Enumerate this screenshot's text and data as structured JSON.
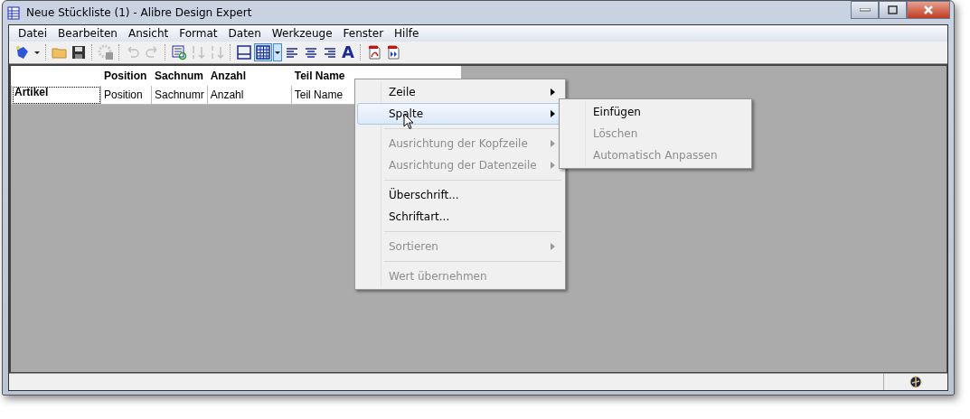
{
  "window": {
    "title": "Neue Stückliste (1) - Alibre Design Expert"
  },
  "menubar": [
    "Datei",
    "Bearbeiten",
    "Ansicht",
    "Format",
    "Daten",
    "Werkzeuge",
    "Fenster",
    "Hilfe"
  ],
  "toolbar": [
    {
      "kind": "new",
      "disabled": false,
      "selected": false
    },
    {
      "kind": "dropdown",
      "disabled": false,
      "selected": false
    },
    {
      "kind": "sep"
    },
    {
      "kind": "open",
      "disabled": false,
      "selected": false
    },
    {
      "kind": "save",
      "disabled": false,
      "selected": false
    },
    {
      "kind": "sep"
    },
    {
      "kind": "settings",
      "disabled": true,
      "selected": false
    },
    {
      "kind": "sep"
    },
    {
      "kind": "undo",
      "disabled": true,
      "selected": false
    },
    {
      "kind": "redo",
      "disabled": true,
      "selected": false
    },
    {
      "kind": "sep"
    },
    {
      "kind": "refresh",
      "disabled": false,
      "selected": false
    },
    {
      "kind": "sortasc",
      "disabled": true,
      "selected": false
    },
    {
      "kind": "sortdesc",
      "disabled": true,
      "selected": false
    },
    {
      "kind": "sep"
    },
    {
      "kind": "border",
      "disabled": false,
      "selected": false
    },
    {
      "kind": "grid",
      "disabled": false,
      "selected": true
    },
    {
      "kind": "dropdown",
      "disabled": false,
      "selected": true
    },
    {
      "kind": "alignleft",
      "disabled": false,
      "selected": false
    },
    {
      "kind": "aligncenter",
      "disabled": false,
      "selected": false
    },
    {
      "kind": "alignright",
      "disabled": false,
      "selected": false
    },
    {
      "kind": "font",
      "glyph": "A",
      "disabled": false,
      "selected": false
    },
    {
      "kind": "sep"
    },
    {
      "kind": "pdf",
      "disabled": false,
      "selected": false
    },
    {
      "kind": "export",
      "disabled": false,
      "selected": false
    }
  ],
  "table": {
    "columns": [
      "Position",
      "Sachnum",
      "Anzahl",
      "Teil Name"
    ],
    "rows": [
      {
        "header": "Artikel",
        "cells": [
          "Position",
          "Sachnumr",
          "Anzahl",
          "Teil Name"
        ]
      }
    ]
  },
  "context_menu": {
    "items": [
      {
        "kind": "item",
        "label": "Zeile",
        "submenu": true,
        "disabled": false,
        "selected": false
      },
      {
        "kind": "item",
        "label": "Spalte",
        "submenu": true,
        "disabled": false,
        "selected": true
      },
      {
        "kind": "separator"
      },
      {
        "kind": "item",
        "label": "Ausrichtung der Kopfzeile",
        "submenu": true,
        "disabled": true,
        "selected": false
      },
      {
        "kind": "item",
        "label": "Ausrichtung der Datenzeile",
        "submenu": true,
        "disabled": true,
        "selected": false
      },
      {
        "kind": "separator"
      },
      {
        "kind": "item",
        "label": "Überschrift...",
        "submenu": false,
        "disabled": false,
        "selected": false
      },
      {
        "kind": "item",
        "label": "Schriftart...",
        "submenu": false,
        "disabled": false,
        "selected": false
      },
      {
        "kind": "separator"
      },
      {
        "kind": "item",
        "label": "Sortieren",
        "submenu": true,
        "disabled": true,
        "selected": false
      },
      {
        "kind": "separator"
      },
      {
        "kind": "item",
        "label": "Wert übernehmen",
        "submenu": false,
        "disabled": true,
        "selected": false
      }
    ]
  },
  "submenu": {
    "items": [
      {
        "label": "Einfügen",
        "disabled": false
      },
      {
        "label": "Löschen",
        "disabled": true
      },
      {
        "label": "Automatisch Anpassen",
        "disabled": true
      }
    ]
  }
}
